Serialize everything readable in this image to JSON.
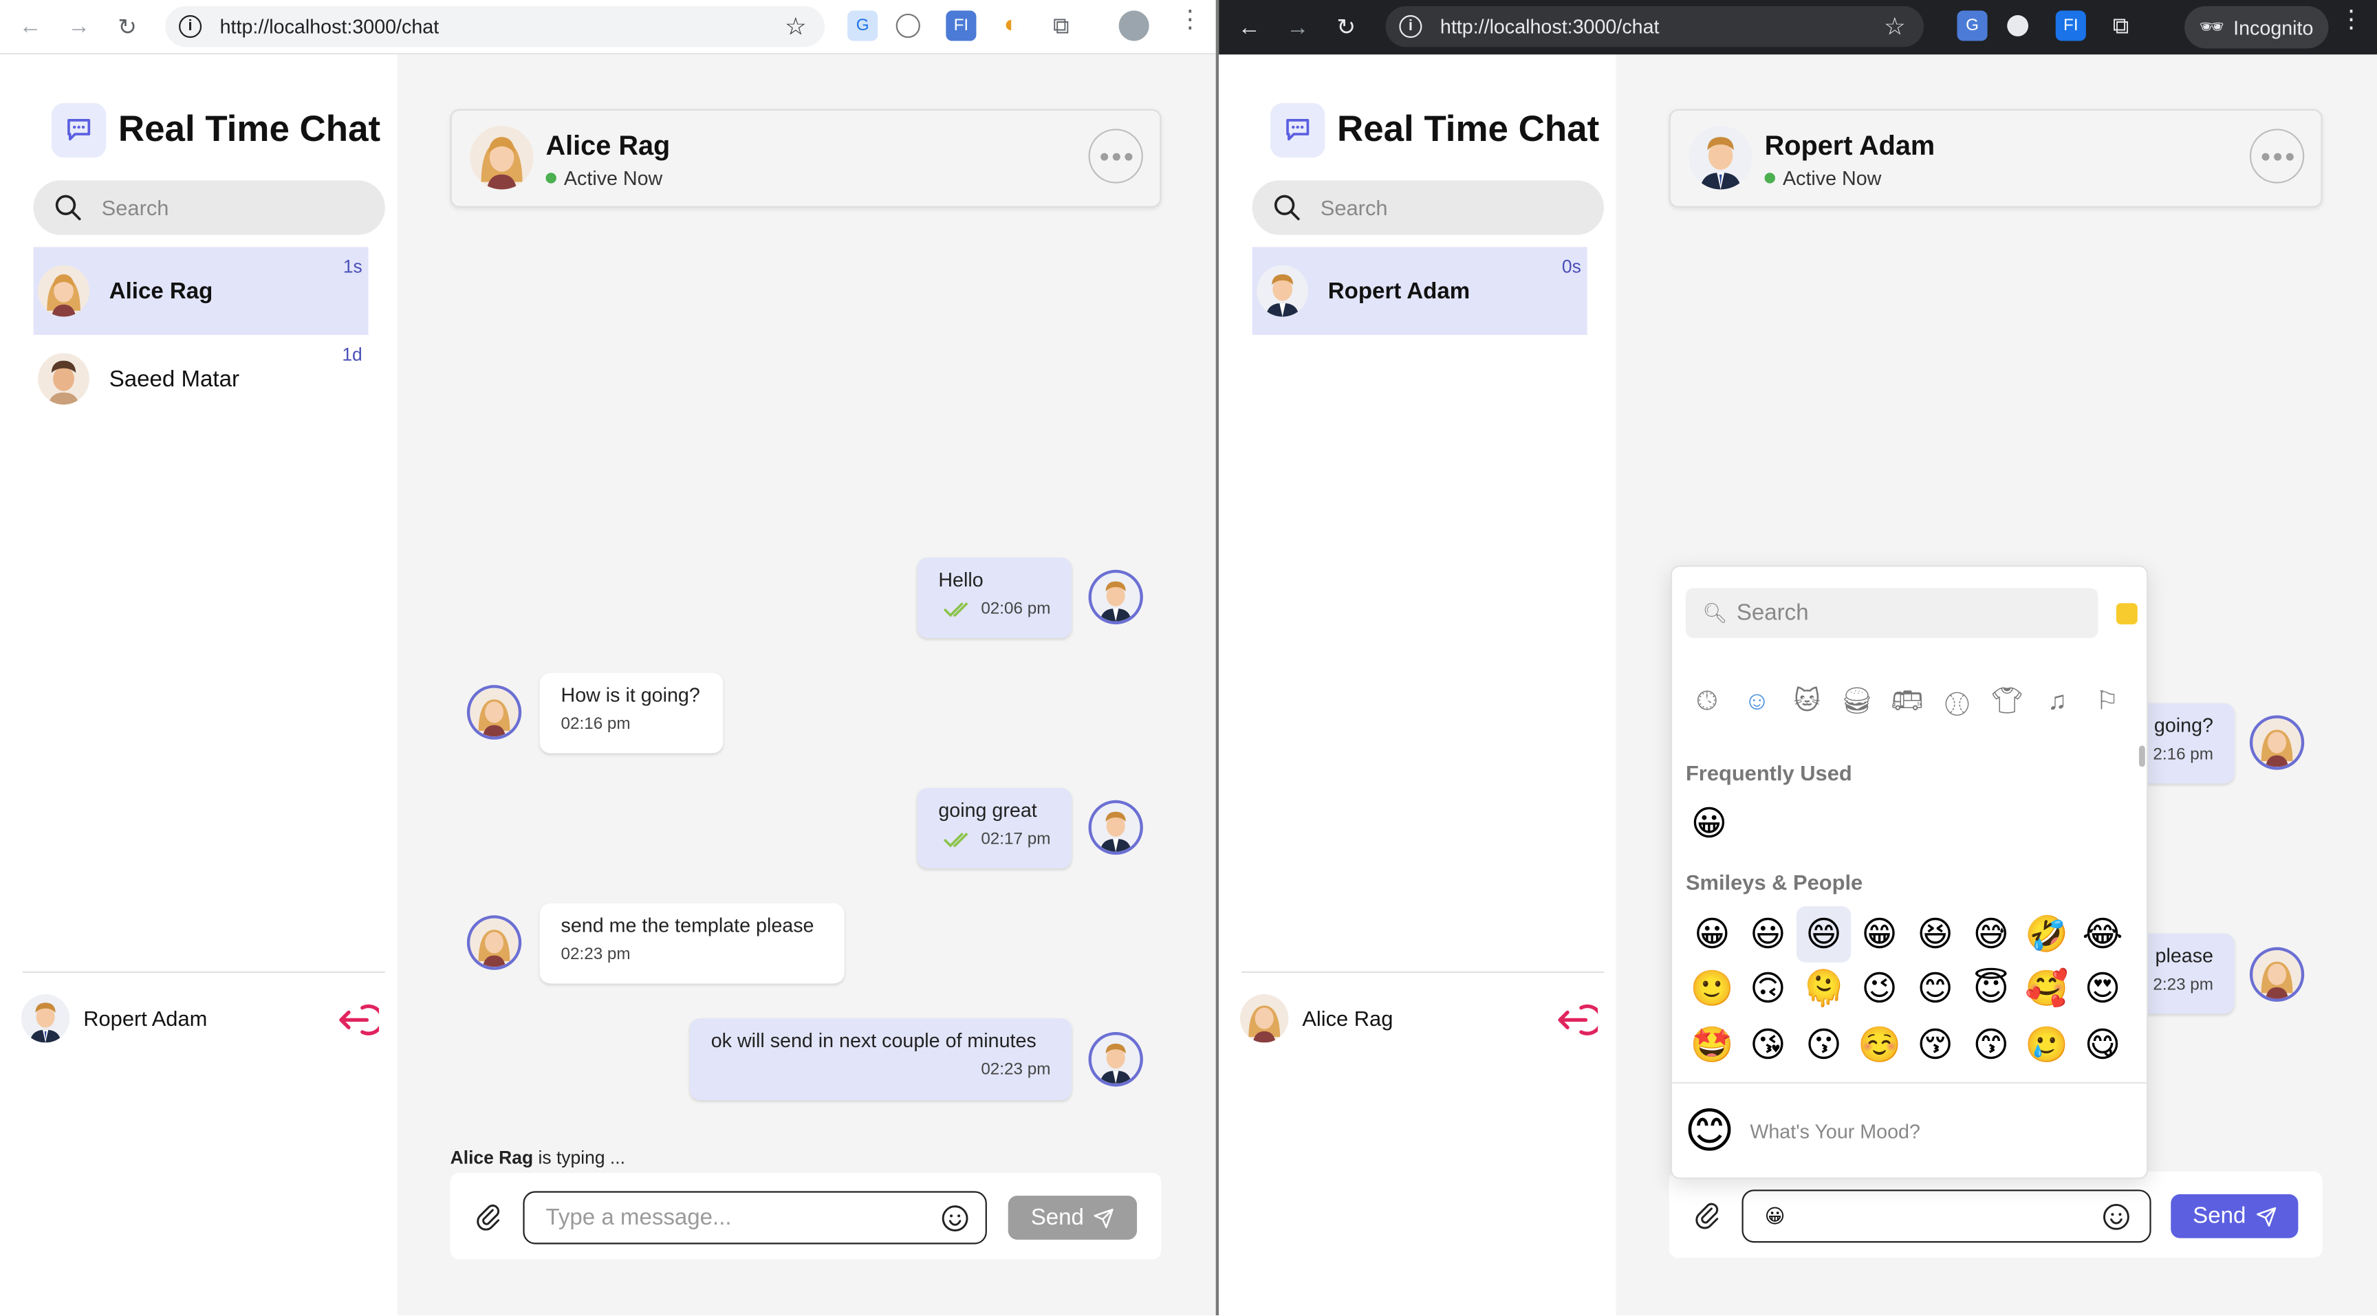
{
  "left": {
    "browser": {
      "url": "http://localhost:3000/chat"
    },
    "app_title": "Real Time Chat",
    "search_placeholder": "Search",
    "contacts": [
      {
        "name": "Alice Rag",
        "time": "1s"
      },
      {
        "name": "Saeed Matar",
        "time": "1d"
      }
    ],
    "current_user": "Ropert Adam",
    "chat_header": {
      "name": "Alice Rag",
      "status": "Active Now"
    },
    "messages": [
      {
        "dir": "out",
        "text": "Hello",
        "time": "02:06 pm"
      },
      {
        "dir": "in",
        "text": "How is it going?",
        "time": "02:16 pm"
      },
      {
        "dir": "out",
        "text": "going great",
        "time": "02:17 pm"
      },
      {
        "dir": "in",
        "text": "send me the template please",
        "time": "02:23 pm"
      },
      {
        "dir": "out",
        "text": "ok will send in next couple of minutes",
        "time": "02:23 pm"
      }
    ],
    "typing_name": "Alice Rag",
    "typing_suffix": " is typing ...",
    "composer": {
      "placeholder": "Type a message...",
      "value": "",
      "send_label": "Send"
    }
  },
  "right": {
    "browser": {
      "url": "http://localhost:3000/chat",
      "incognito_label": "Incognito"
    },
    "app_title": "Real Time Chat",
    "search_placeholder": "Search",
    "contacts": [
      {
        "name": "Ropert Adam",
        "time": "0s"
      }
    ],
    "current_user": "Alice Rag",
    "chat_header": {
      "name": "Ropert Adam",
      "status": "Active Now"
    },
    "messages_partial": [
      {
        "dir": "out",
        "text": "going?",
        "time": "2:16 pm"
      },
      {
        "dir": "out",
        "text": "please",
        "time": "2:23 pm"
      }
    ],
    "emoji_picker": {
      "search_placeholder": "Search",
      "categories": [
        "clock-icon",
        "smiley-icon",
        "cat-icon",
        "burger-icon",
        "bus-icon",
        "ball-icon",
        "shirt-icon",
        "music-icon",
        "flag-icon"
      ],
      "frequently_used_label": "Frequently Used",
      "frequently_used": [
        "😀"
      ],
      "smileys_label": "Smileys & People",
      "smileys": [
        "😀",
        "😃",
        "😄",
        "😁",
        "😆",
        "😅",
        "🤣",
        "😂",
        "🙂",
        "🙃",
        "🫠",
        "😉",
        "😊",
        "😇",
        "🥰",
        "😍",
        "🤩",
        "😘",
        "😗",
        "☺️",
        "😚",
        "😙",
        "🥲",
        "😋",
        "😛",
        "😜",
        "🤪",
        "😝",
        "🤑",
        "🤗",
        "🤭",
        "🫢"
      ],
      "preview_emoji": "😊",
      "preview_text": "What's Your Mood?"
    },
    "composer": {
      "value": "😀",
      "send_label": "Send"
    }
  },
  "colors": {
    "accent": "#5b5fe0",
    "selected_bg": "#e2e5f9",
    "logout": "#e0245e",
    "online": "#4caf50"
  }
}
